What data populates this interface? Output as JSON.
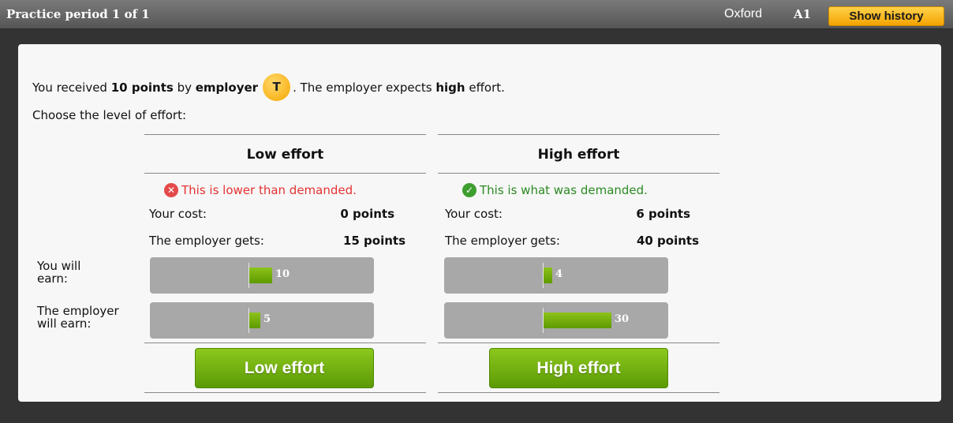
{
  "header": {
    "title": "Practice period 1 of 1",
    "city": "Oxford",
    "subject": "A1",
    "history_button": "Show history"
  },
  "intro": {
    "p1": "You received ",
    "points": "10 points",
    "p2": " by ",
    "employer_word": "employer",
    "avatar_letter": "T",
    "p3": ". The employer expects ",
    "expected": "high",
    "p4": " effort."
  },
  "choose_text": "Choose the level of effort:",
  "row_labels": {
    "you_earn": "You will\nearn:",
    "employer_earn": "The employer\nwill earn:"
  },
  "options": [
    {
      "heading": "Low effort",
      "status": "This is lower than demanded.",
      "status_type": "bad",
      "cost_label": "Your cost:",
      "cost_value": "0 points",
      "gets_label": "The employer gets:",
      "gets_value": "15 points",
      "you_earn": "10",
      "employer_earn": "5",
      "you_earn_value": 10,
      "employer_earn_value": 5,
      "button": "Low effort"
    },
    {
      "heading": "High effort",
      "status": "This is what was demanded.",
      "status_type": "good",
      "cost_label": "Your cost:",
      "cost_value": "6 points",
      "gets_label": "The employer gets:",
      "gets_value": "40 points",
      "you_earn": "4",
      "employer_earn": "30",
      "you_earn_value": 4,
      "employer_earn_value": 30,
      "button": "High effort"
    }
  ],
  "colors": {
    "accent_green": "#6aab08",
    "error_red": "#e43232",
    "ok_green": "#2a8a22",
    "history_orange": "#f4a200"
  }
}
